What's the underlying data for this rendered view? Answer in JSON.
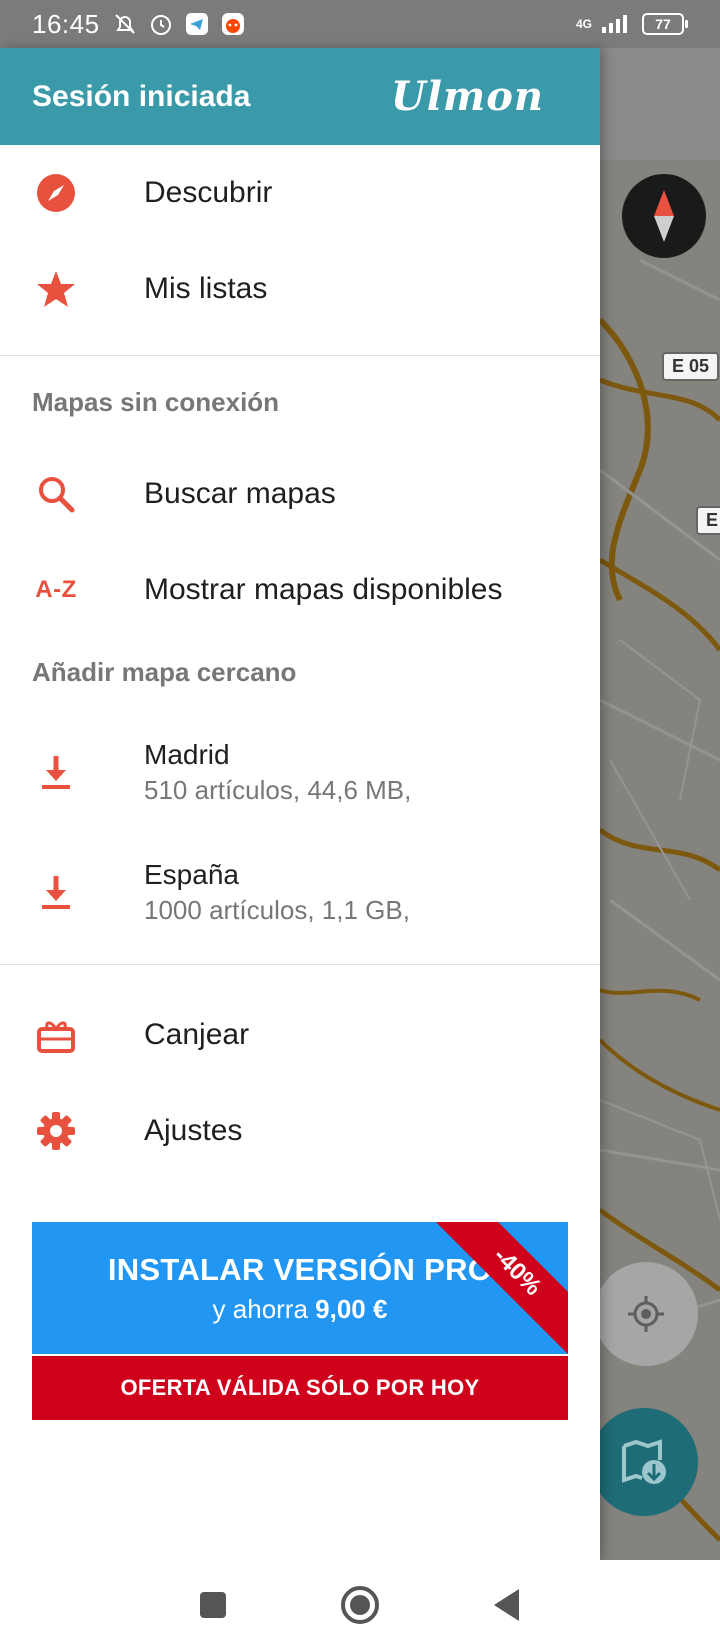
{
  "status_bar": {
    "time": "16:45",
    "network": "4G",
    "battery": "77"
  },
  "map": {
    "road_labels": [
      "E 05",
      "E"
    ]
  },
  "drawer": {
    "header_title": "Sesión iniciada",
    "logo": "Ulmon",
    "items_top": [
      {
        "label": "Descubrir",
        "icon": "compass-icon"
      },
      {
        "label": "Mis listas",
        "icon": "star-icon"
      }
    ],
    "offline_section_title": "Mapas sin conexión",
    "offline_items": [
      {
        "label": "Buscar mapas",
        "icon": "search-icon"
      },
      {
        "label": "Mostrar mapas disponibles",
        "icon_text": "A-Z"
      }
    ],
    "nearby_section_title": "Añadir mapa cercano",
    "nearby_maps": [
      {
        "name": "Madrid",
        "details": "510 artículos, 44,6 MB,"
      },
      {
        "name": "España",
        "details": "1000 artículos, 1,1 GB,"
      }
    ],
    "items_bottom": [
      {
        "label": "Canjear",
        "icon": "gift-icon"
      },
      {
        "label": "Ajustes",
        "icon": "gear-icon"
      }
    ],
    "pro_banner": {
      "title": "INSTALAR VERSIÓN PRO",
      "subtitle_prefix": "y ahorra ",
      "savings": "9,00 €",
      "discount": "-40%",
      "offer": "OFERTA VÁLIDA SÓLO POR HOY"
    }
  },
  "colors": {
    "header": "#3a9aaa",
    "accent_icon": "#e8513e",
    "pro_blue": "#2196f3",
    "offer_red": "#d0021b"
  }
}
